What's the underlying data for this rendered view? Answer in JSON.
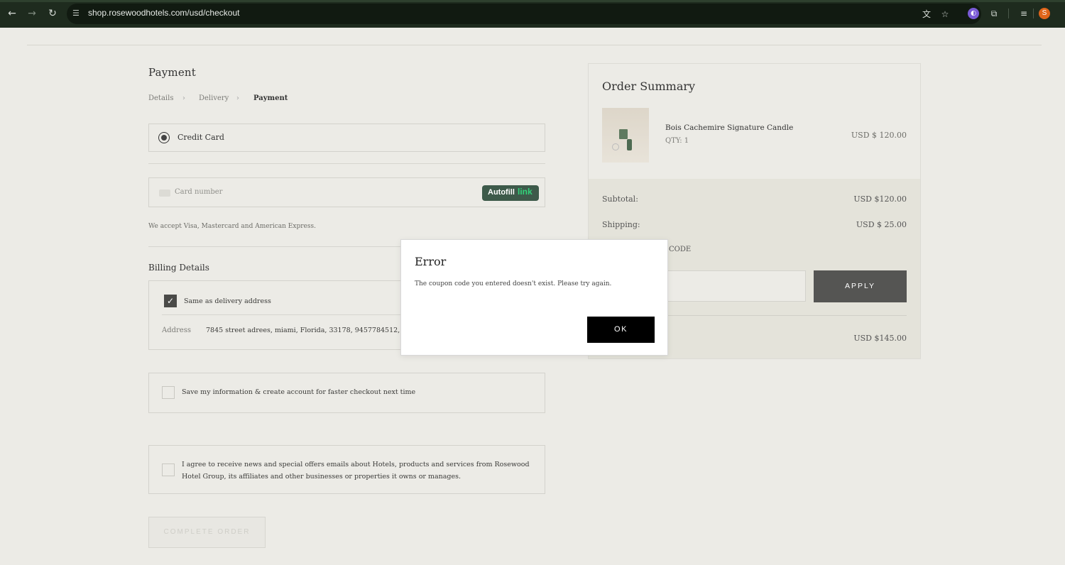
{
  "browser": {
    "url": "shop.rosewoodhotels.com/usd/checkout",
    "avatar_letter": "S"
  },
  "payment": {
    "title": "Payment",
    "breadcrumb": [
      "Details",
      "Delivery",
      "Payment"
    ],
    "method_label": "Credit Card",
    "card_placeholder": "Card number",
    "autofill": "Autofill",
    "autofill_link": "link",
    "accept_note": "We accept Visa, Mastercard and American Express."
  },
  "billing": {
    "title": "Billing Details",
    "same_as_delivery": "Same as delivery address",
    "address_label": "Address",
    "address_value": "7845 street adrees, miami, Florida, 33178, 9457784512, United S"
  },
  "options": {
    "save_info": "Save my information & create account for faster checkout next time",
    "agree_news": "I agree to receive news and special offers emails about Hotels, products and services from Rosewood Hotel Group, its affiliates and other businesses or properties it owns or manages."
  },
  "complete_order": "COMPLETE ORDER",
  "summary": {
    "title": "Order Summary",
    "product_name": "Bois Cachemire Signature Candle",
    "product_qty": "QTY: 1",
    "product_price": "USD $ 120.00",
    "subtotal_label": "Subtotal:",
    "subtotal_value": "USD $120.00",
    "shipping_label": "Shipping:",
    "shipping_value": "USD $ 25.00",
    "code_label": "CODE",
    "apply": "APPLY",
    "total_value": "USD $145.00"
  },
  "modal": {
    "title": "Error",
    "message": "The coupon code you entered doesn't exist. Please try again.",
    "ok": "OK"
  }
}
